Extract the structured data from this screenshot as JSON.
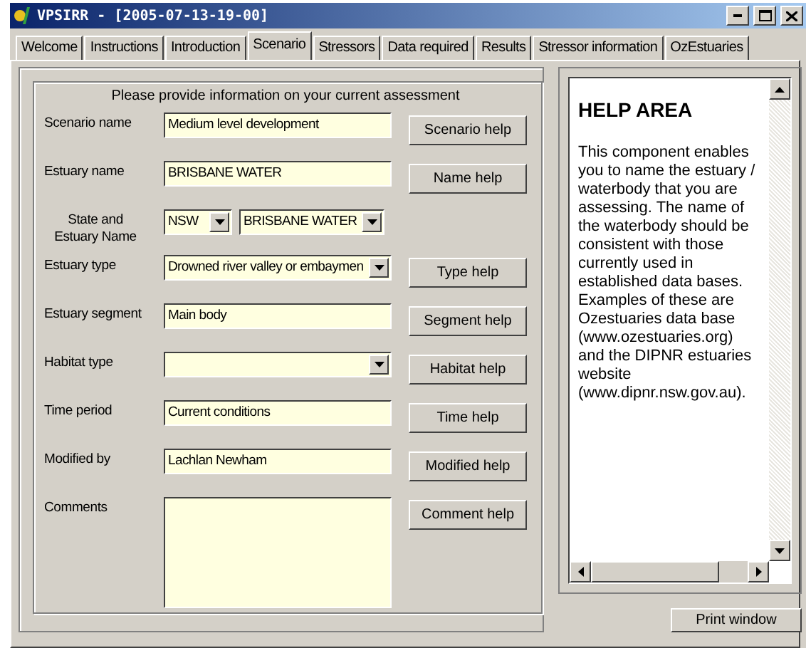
{
  "window": {
    "title": "VPSIRR - [2005-07-13-19-00]"
  },
  "tabs": [
    {
      "label": "Welcome",
      "selected": false
    },
    {
      "label": "Instructions",
      "selected": false
    },
    {
      "label": "Introduction",
      "selected": false
    },
    {
      "label": "Scenario",
      "selected": true
    },
    {
      "label": "Stressors",
      "selected": false
    },
    {
      "label": "Data required",
      "selected": false
    },
    {
      "label": "Results",
      "selected": false
    },
    {
      "label": "Stressor information",
      "selected": false
    },
    {
      "label": "OzEstuaries",
      "selected": false
    }
  ],
  "form": {
    "heading": "Please provide information on your current assessment",
    "rows": [
      {
        "kind": "text",
        "label": "Scenario name",
        "value": "Medium level development",
        "help": "Scenario help"
      },
      {
        "kind": "text",
        "label": "Estuary name",
        "value": "BRISBANE WATER",
        "help": "Name help"
      },
      {
        "kind": "dual-select",
        "label": "State and Estuary Name",
        "value": "NSW",
        "value_2": "BRISBANE WATER"
      },
      {
        "kind": "select",
        "label": "Estuary type",
        "value": "Drowned river valley or embaymen",
        "help": "Type help"
      },
      {
        "kind": "text",
        "label": "Estuary segment",
        "value": "Main body",
        "help": "Segment help"
      },
      {
        "kind": "select",
        "label": "Habitat type",
        "help": "Habitat help"
      },
      {
        "kind": "text",
        "label": "Time period",
        "value": "Current conditions",
        "help": "Time help"
      },
      {
        "kind": "text",
        "label": "Modified by",
        "value": "Lachlan Newham",
        "help": "Modified help"
      },
      {
        "kind": "textarea",
        "label": "Comments",
        "help": "Comment help"
      }
    ]
  },
  "help_area": {
    "title": "HELP AREA",
    "text": "This component enables you to name the estuary / waterbody that you are assessing.  The name of the waterbody should be consistent with those currently used in established data bases.  Examples of these are Ozestuaries data base (www.ozestuaries.org) and the DIPNR estuaries website (www.dipnr.nsw.gov.au)."
  },
  "buttons": [
    "Print window"
  ]
}
